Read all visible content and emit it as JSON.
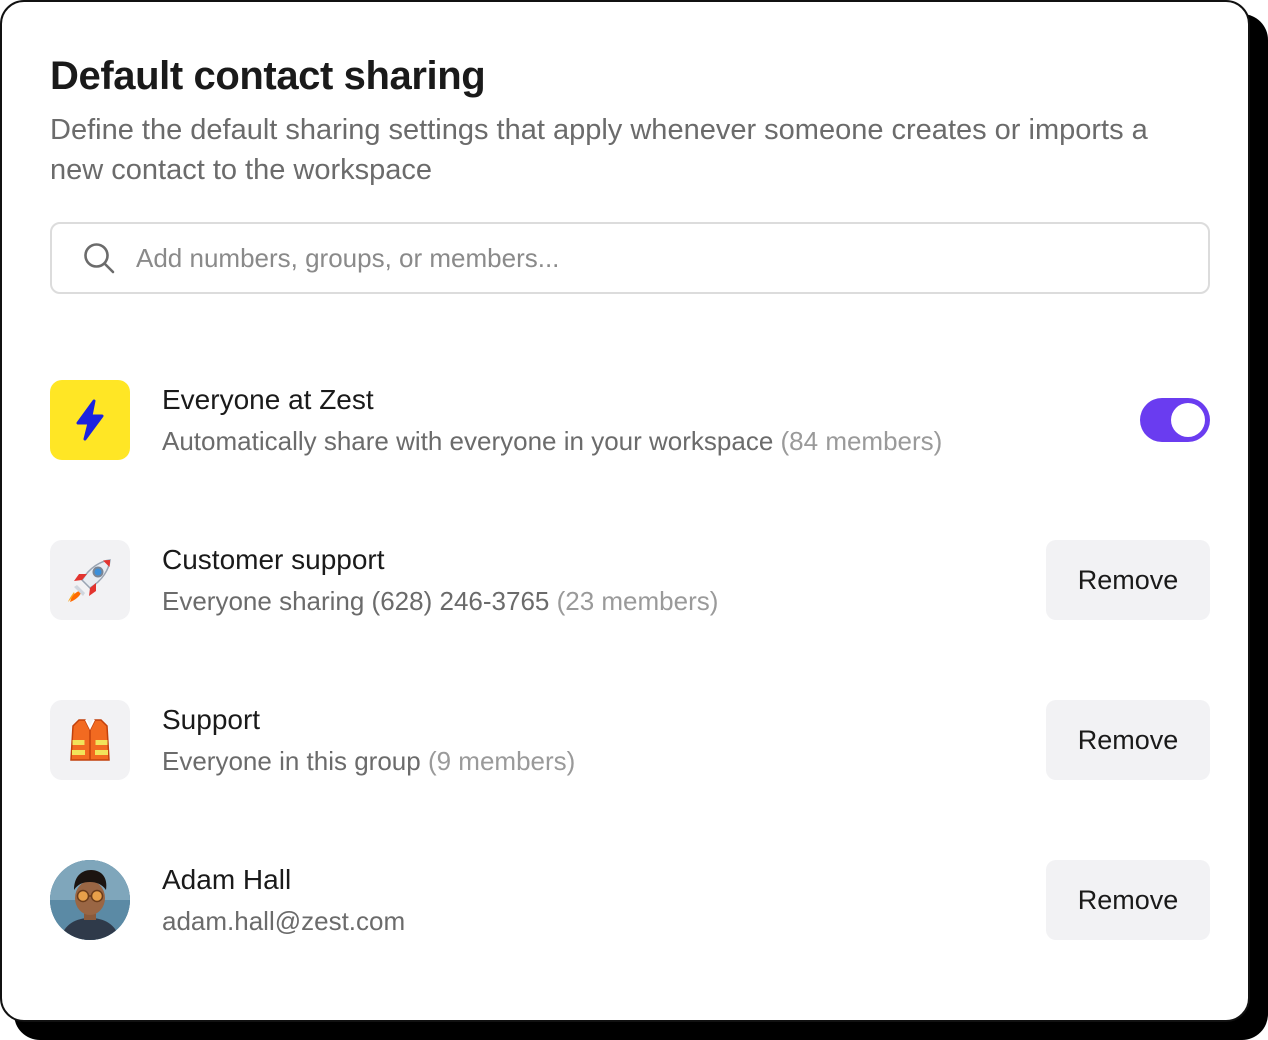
{
  "header": {
    "title": "Default contact sharing",
    "subtitle": "Define the default sharing settings that apply whenever someone creates or imports a new contact to the workspace"
  },
  "search": {
    "placeholder": "Add numbers, groups, or members...",
    "icon": "search-icon"
  },
  "colors": {
    "accent": "#6a3cf0",
    "workspace_icon_bg": "#ffe625",
    "bolt": "#1a22e0",
    "button_bg": "#f2f2f4"
  },
  "entries": [
    {
      "title": "Everyone at Zest",
      "subtitle": "Automatically share with everyone in your workspace",
      "count": "(84 members)",
      "icon": "lightning-bolt-icon",
      "control": "toggle",
      "enabled": true
    },
    {
      "title": "Customer support",
      "subtitle": "Everyone sharing (628) 246-3765",
      "count": "(23 members)",
      "icon": "rocket-icon",
      "action_label": "Remove"
    },
    {
      "title": "Support",
      "subtitle": "Everyone in this group",
      "count": "(9 members)",
      "icon": "safety-vest-icon",
      "action_label": "Remove"
    },
    {
      "title": "Adam Hall",
      "subtitle": "adam.hall@zest.com",
      "icon": "avatar",
      "action_label": "Remove"
    }
  ]
}
